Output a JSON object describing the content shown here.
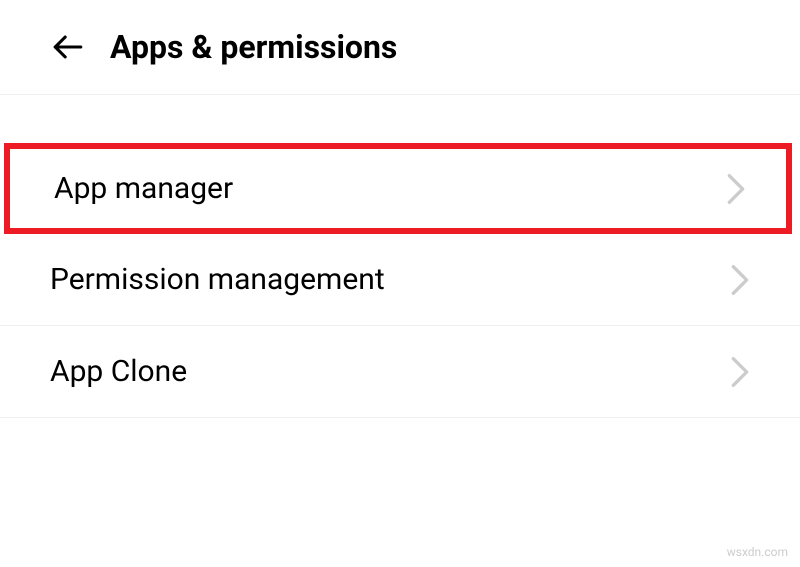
{
  "header": {
    "title": "Apps & permissions"
  },
  "items": [
    {
      "label": "App manager",
      "highlighted": true
    },
    {
      "label": "Permission management",
      "highlighted": false
    },
    {
      "label": "App Clone",
      "highlighted": false
    }
  ],
  "watermark": "wsxdn.com"
}
